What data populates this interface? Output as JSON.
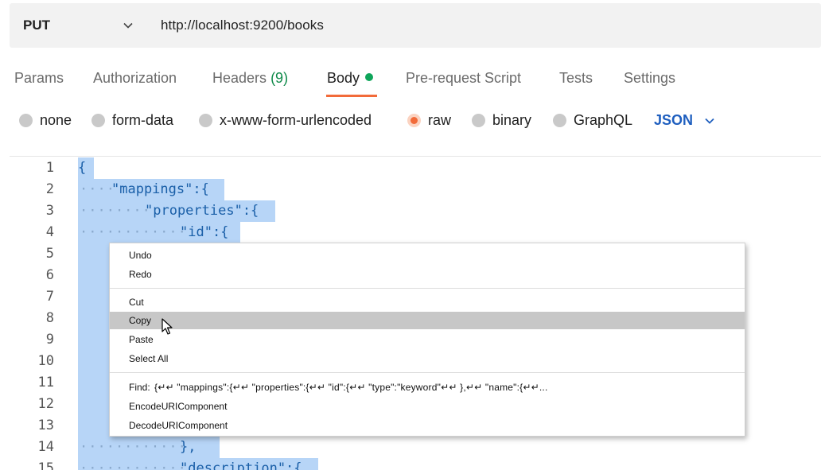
{
  "request": {
    "method": "PUT",
    "url": "http://localhost:9200/books",
    "method_chevron_icon": "chevron-down-icon"
  },
  "tabs": [
    {
      "label": "Params"
    },
    {
      "label": "Authorization"
    },
    {
      "label": "Headers",
      "count": "(9)"
    },
    {
      "label": "Body",
      "active": true
    },
    {
      "label": "Pre-request Script"
    },
    {
      "label": "Tests"
    },
    {
      "label": "Settings"
    }
  ],
  "body_types": [
    {
      "label": "none",
      "checked": false
    },
    {
      "label": "form-data",
      "checked": false
    },
    {
      "label": "x-www-form-urlencoded",
      "checked": false
    },
    {
      "label": "raw",
      "checked": true
    },
    {
      "label": "binary",
      "checked": false
    },
    {
      "label": "GraphQL",
      "checked": false
    }
  ],
  "language": {
    "selected": "JSON",
    "chevron_icon": "chevron-down-icon"
  },
  "editor": {
    "lines": [
      {
        "num": "1",
        "code": "{"
      },
      {
        "num": "2",
        "code": "\"mappings\":{"
      },
      {
        "num": "3",
        "code": "\"properties\":{"
      },
      {
        "num": "4",
        "code": "\"id\":{"
      },
      {
        "num": "5",
        "code": ""
      },
      {
        "num": "6",
        "code": ""
      },
      {
        "num": "7",
        "code": ""
      },
      {
        "num": "8",
        "code": ""
      },
      {
        "num": "9",
        "code": ""
      },
      {
        "num": "10",
        "code": ""
      },
      {
        "num": "11",
        "code": ""
      },
      {
        "num": "12",
        "code": ""
      },
      {
        "num": "13",
        "code": ""
      },
      {
        "num": "14",
        "code": "},"
      },
      {
        "num": "15",
        "code": "\"description\":{"
      }
    ]
  },
  "context_menu": {
    "undo": "Undo",
    "redo": "Redo",
    "cut": "Cut",
    "copy": "Copy",
    "paste": "Paste",
    "select_all": "Select All",
    "find_label": "Find:",
    "find_query": "{↵↵     \"mappings\":{↵↵        \"properties\":{↵↵          \"id\":{↵↵              \"type\":\"keyword\"↵↵         },↵↵         \"name\":{↵↵...",
    "encode": "EncodeURIComponent",
    "decode": "DecodeURIComponent",
    "hovered_item": "Copy"
  },
  "colors": {
    "accent": "#f26b3a",
    "active_dot": "#0fa55a",
    "json_blue": "#1f5fbf",
    "selection": "#b7d5f7",
    "menu_hover": "#c7c7c7"
  }
}
